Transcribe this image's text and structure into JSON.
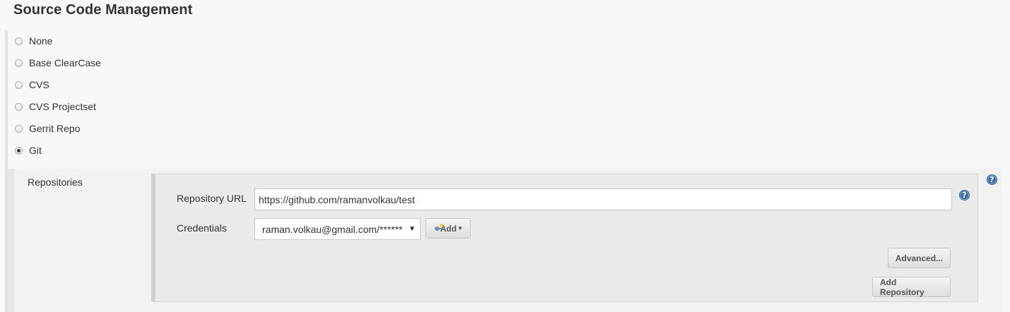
{
  "section": {
    "title": "Source Code Management"
  },
  "scm_options": [
    {
      "label": "None",
      "selected": false
    },
    {
      "label": "Base ClearCase",
      "selected": false
    },
    {
      "label": "CVS",
      "selected": false
    },
    {
      "label": "CVS Projectset",
      "selected": false
    },
    {
      "label": "Gerrit Repo",
      "selected": false
    },
    {
      "label": "Git",
      "selected": true
    }
  ],
  "git": {
    "repositories_label": "Repositories",
    "repository_url_label": "Repository URL",
    "repository_url_value": "https://github.com/ramanvolkau/test",
    "credentials_label": "Credentials",
    "credentials_selected": "raman.volkau@gmail.com/******",
    "add_button_label": "Add",
    "advanced_button_label": "Advanced...",
    "add_repository_button_label": "Add Repository",
    "help_glyph": "?"
  },
  "icons": {
    "help": "help-icon",
    "key": "key-icon",
    "dropdown": "chevron-down-icon"
  },
  "colors": {
    "help_blue": "#3a6ea5",
    "panel_bg": "#eaeaea",
    "page_bg": "#f8f8f8"
  }
}
